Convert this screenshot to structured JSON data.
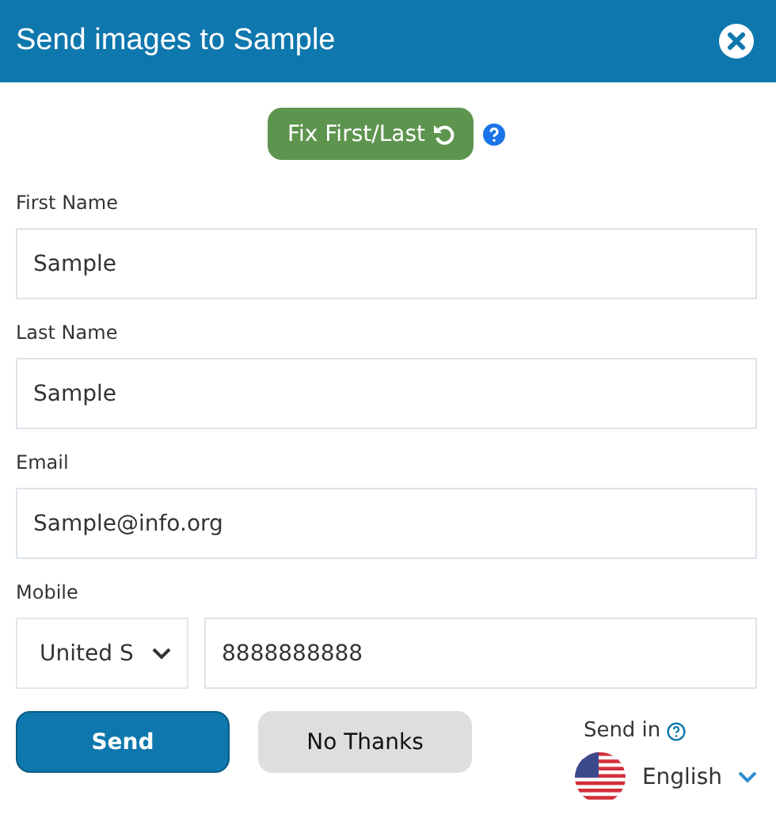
{
  "window": {
    "title": "Send images to Sample"
  },
  "fix_button": {
    "label": "Fix First/Last"
  },
  "fields": [
    {
      "label": "First Name",
      "value": "Sample"
    },
    {
      "label": "Last Name",
      "value": "Sample"
    },
    {
      "label": "Email",
      "value": "Sample@info.org"
    }
  ],
  "mobile": {
    "label": "Mobile",
    "country": "United S",
    "number": "8888888888"
  },
  "buttons": [
    {
      "label": "Send",
      "kind": "primary"
    },
    {
      "label": "No Thanks",
      "kind": "secondary"
    }
  ],
  "language": {
    "label": "Send in",
    "value": "English"
  }
}
